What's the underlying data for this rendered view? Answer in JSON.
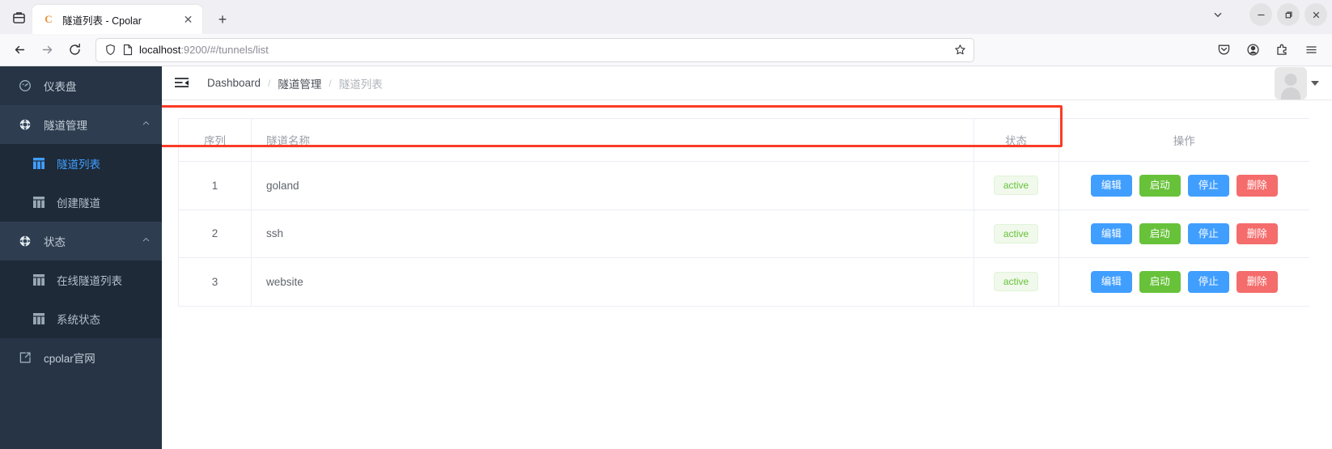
{
  "browser": {
    "tab": {
      "title": "隧道列表 - Cpolar",
      "favicon_letter": "C",
      "favicon_color": "#e8913a",
      "close_label": "✕"
    },
    "new_tab_label": "+",
    "tab_list_chevron": "⌄",
    "window_controls": {
      "minimize": "—",
      "maximize": "❐",
      "close": "✕"
    },
    "nav": {
      "back": "←",
      "forward": "→",
      "reload": "⟳"
    },
    "url": {
      "host": "localhost",
      "rest": ":9200/#/tunnels/list",
      "full": "localhost:9200/#/tunnels/list"
    },
    "toolbar_icons": [
      "shield-icon",
      "page-icon",
      "bookmark-star-icon",
      "pocket-icon",
      "account-icon",
      "extensions-icon",
      "app-menu-icon"
    ]
  },
  "sidebar": {
    "items": [
      {
        "label": "仪表盘",
        "icon": "gauge-icon",
        "type": "item",
        "name": "sidebar-item-dashboard"
      },
      {
        "label": "隧道管理",
        "icon": "node-icon",
        "type": "group",
        "chevron": "⌃",
        "name": "sidebar-group-tunnel-management"
      },
      {
        "label": "隧道列表",
        "icon": "table-icon",
        "type": "sub",
        "active": true,
        "name": "sidebar-item-tunnel-list"
      },
      {
        "label": "创建隧道",
        "icon": "table-icon",
        "type": "sub",
        "active": false,
        "name": "sidebar-item-create-tunnel"
      },
      {
        "label": "状态",
        "icon": "node-icon",
        "type": "group",
        "chevron": "⌃",
        "name": "sidebar-group-status"
      },
      {
        "label": "在线隧道列表",
        "icon": "table-icon",
        "type": "sub",
        "active": false,
        "name": "sidebar-item-online-tunnel-list"
      },
      {
        "label": "系统状态",
        "icon": "table-icon",
        "type": "sub",
        "active": false,
        "name": "sidebar-item-system-status"
      },
      {
        "label": "cpolar官网",
        "icon": "external-link-icon",
        "type": "item",
        "name": "sidebar-item-cpolar-website"
      }
    ],
    "bg_color": "#263445",
    "active_color": "#409eff"
  },
  "header": {
    "fold_icon": "menu-fold-icon",
    "breadcrumb": [
      {
        "label": "Dashboard",
        "current": false
      },
      {
        "label": "隧道管理",
        "current": false
      },
      {
        "label": "隧道列表",
        "current": true
      }
    ],
    "separator": "/"
  },
  "table": {
    "columns": [
      {
        "key": "seq",
        "label": "序列"
      },
      {
        "key": "name",
        "label": "隧道名称"
      },
      {
        "key": "status",
        "label": "状态"
      },
      {
        "key": "ops",
        "label": "操作"
      }
    ],
    "rows": [
      {
        "seq": "1",
        "name": "goland",
        "status": "active"
      },
      {
        "seq": "2",
        "name": "ssh",
        "status": "active"
      },
      {
        "seq": "3",
        "name": "website",
        "status": "active"
      }
    ],
    "buttons": [
      {
        "label": "编辑",
        "style": "primary",
        "name": "edit-button"
      },
      {
        "label": "启动",
        "style": "success",
        "name": "start-button"
      },
      {
        "label": "停止",
        "style": "primary",
        "name": "stop-button"
      },
      {
        "label": "删除",
        "style": "danger",
        "name": "delete-button"
      }
    ],
    "status_colors": {
      "text": "#67c23a",
      "bg": "#f0f9eb"
    }
  },
  "annotation": {
    "highlight_color": "#fb3b25",
    "target_row": "1"
  }
}
